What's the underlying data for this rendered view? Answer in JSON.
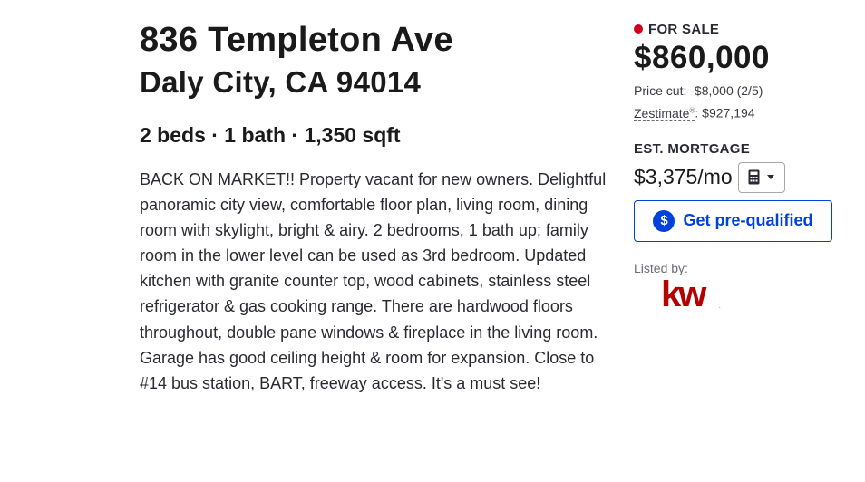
{
  "address": {
    "street": "836 Templeton Ave",
    "city_state_zip": "Daly City, CA 94014"
  },
  "facts": "2 beds · 1 bath · 1,350 sqft",
  "description": "BACK ON MARKET!! Property vacant for new owners. Delightful panoramic city view, comfortable floor plan, living room, dining room with skylight, bright & airy. 2 bedrooms, 1 bath up; family room in the lower level can be used as 3rd bedroom. Updated kitchen with granite counter top, wood cabinets, stainless steel refrigerator & gas cooking range. There are hardwood floors throughout, double pane windows & fireplace in the living room. Garage has good ceiling height & room for expansion. Close to #14 bus station, BART, freeway access. It's a must see!",
  "status": {
    "label": "FOR SALE",
    "dot_color": "#d0021b"
  },
  "price": "$860,000",
  "price_cut": "Price cut: -$8,000 (2/5)",
  "zestimate": {
    "label": "Zestimate",
    "mark": "®",
    "value": ": $927,194"
  },
  "mortgage": {
    "heading": "EST. MORTGAGE",
    "value": "$3,375/mo",
    "calculator_icon": "calculator-icon"
  },
  "prequalify": {
    "label": "Get pre-qualified",
    "icon": "dollar-circle-icon",
    "symbol": "$",
    "accent": "#0041d9"
  },
  "listed_by": {
    "label": "Listed by:",
    "logo_text": "kw",
    "logo_color": "#b40101"
  }
}
